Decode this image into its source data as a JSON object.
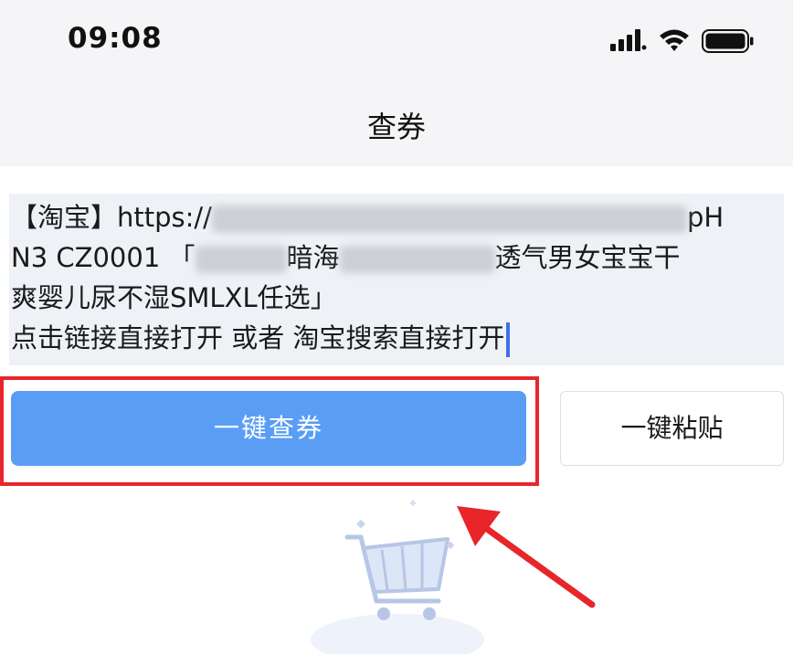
{
  "status_bar": {
    "time": "09:08",
    "icons": [
      "signal-icon",
      "wifi-icon",
      "battery-icon"
    ]
  },
  "nav": {
    "title": "查券"
  },
  "input": {
    "line1_prefix": "【淘宝】https://",
    "line1_suffix": "pH",
    "line2_prefix": "N3 CZ0001 「",
    "line2_middle": "暗海",
    "line2_suffix": "透气男女宝宝干",
    "line3": "爽婴儿尿不湿SMLXL任选」",
    "line4": "点击链接直接打开 或者 淘宝搜索直接打开"
  },
  "buttons": {
    "query_label": "一键查券",
    "paste_label": "一键粘贴"
  },
  "colors": {
    "primary_button": "#5a9df5",
    "highlight_border": "#e8262a",
    "caret": "#3d6fe8",
    "input_bg": "#eef1f5"
  },
  "illustration": {
    "icon": "shopping-cart-icon",
    "annotation": "red-arrow-icon"
  }
}
